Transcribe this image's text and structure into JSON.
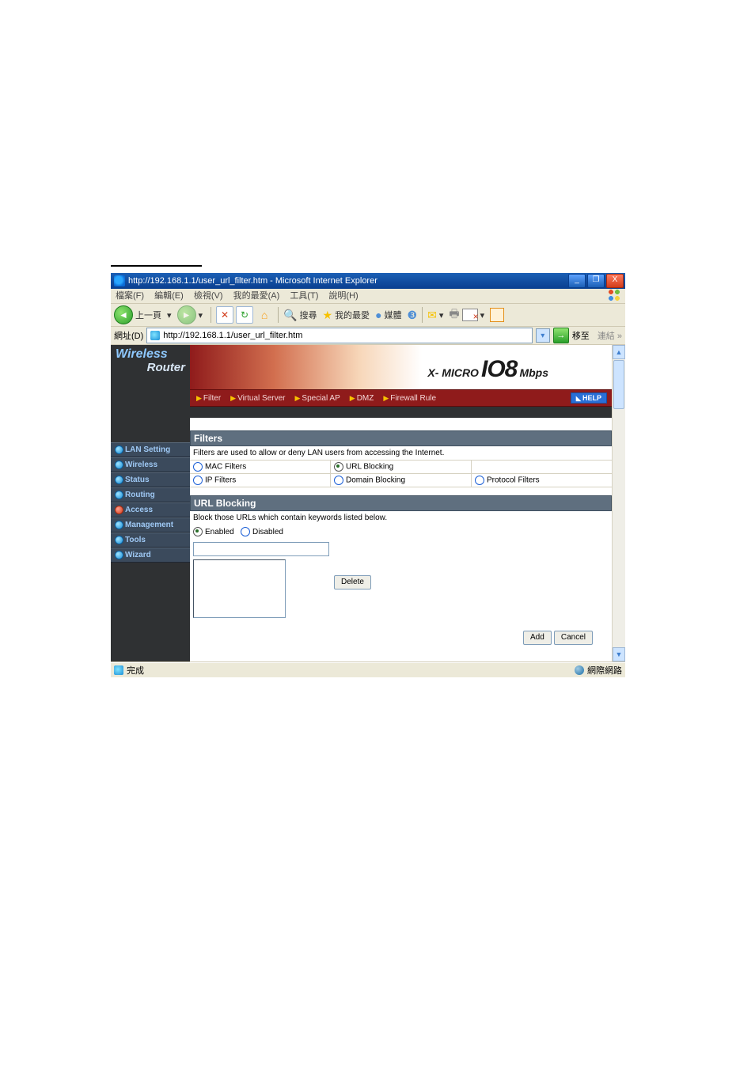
{
  "window": {
    "title": "http://192.168.1.1/user_url_filter.htm - Microsoft Internet Explorer",
    "min": "_",
    "max": "❐",
    "close": "X"
  },
  "menus": {
    "file": "檔案(F)",
    "edit": "編輯(E)",
    "view": "檢視(V)",
    "fav": "我的最愛(A)",
    "tools": "工具(T)",
    "help": "說明(H)"
  },
  "toolbar": {
    "back": "上一頁",
    "search": "搜尋",
    "fav": "我的最愛",
    "media": "媒體"
  },
  "address": {
    "label": "網址(D)",
    "url": "http://192.168.1.1/user_url_filter.htm",
    "go": "移至",
    "links": "連結 »"
  },
  "brand": {
    "line1": "Wireless",
    "line2": "Router",
    "banner_x": "X- MICRO",
    "banner_io8": "IO8",
    "banner_mbps": "Mbps"
  },
  "nav": {
    "lan": "LAN Setting",
    "wireless": "Wireless",
    "status": "Status",
    "routing": "Routing",
    "access": "Access",
    "management": "Management",
    "tools": "Tools",
    "wizard": "Wizard"
  },
  "tabs": {
    "filter": "Filter",
    "vserver": "Virtual Server",
    "specialap": "Special AP",
    "dmz": "DMZ",
    "fwrule": "Firewall Rule",
    "help": "HELP"
  },
  "filters": {
    "title": "Filters",
    "desc": "Filters are used to allow or deny LAN users from accessing the Internet.",
    "mac": "MAC Filters",
    "url": "URL Blocking",
    "ip": "IP Filters",
    "domain": "Domain Blocking",
    "protocol": "Protocol Filters"
  },
  "urlblock": {
    "title": "URL Blocking",
    "desc": "Block those URLs which contain keywords listed below.",
    "enabled": "Enabled",
    "disabled": "Disabled",
    "delete": "Delete",
    "add": "Add",
    "cancel": "Cancel"
  },
  "status": {
    "done": "完成",
    "zone": "網際網路"
  }
}
